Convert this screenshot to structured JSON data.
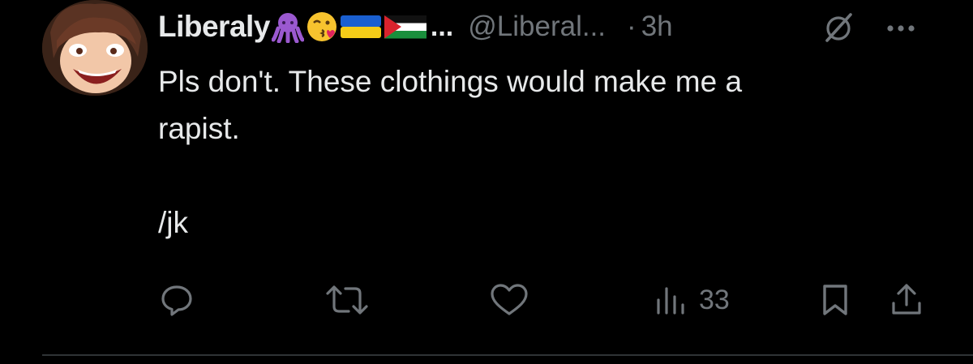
{
  "tweet": {
    "author_name": "Liberaly",
    "name_emojis": [
      "octopus-emoji",
      "kissing-face-emoji",
      "ukraine-flag-emoji",
      "palestine-flag-emoji"
    ],
    "ellipsis": "...",
    "handle": "@Liberal...",
    "dot": "·",
    "time": "3h",
    "text": "Pls don't. These clothings would make me a\nrapist.\n\n/jk",
    "views_count": "33"
  },
  "colors": {
    "background": "#000000",
    "text_primary": "#e7e9ea",
    "text_secondary": "#71767b",
    "divider": "#2f3336"
  },
  "icons": [
    "grok-icon",
    "more-icon",
    "reply-icon",
    "retweet-icon",
    "like-icon",
    "views-icon",
    "bookmark-icon",
    "share-icon"
  ]
}
